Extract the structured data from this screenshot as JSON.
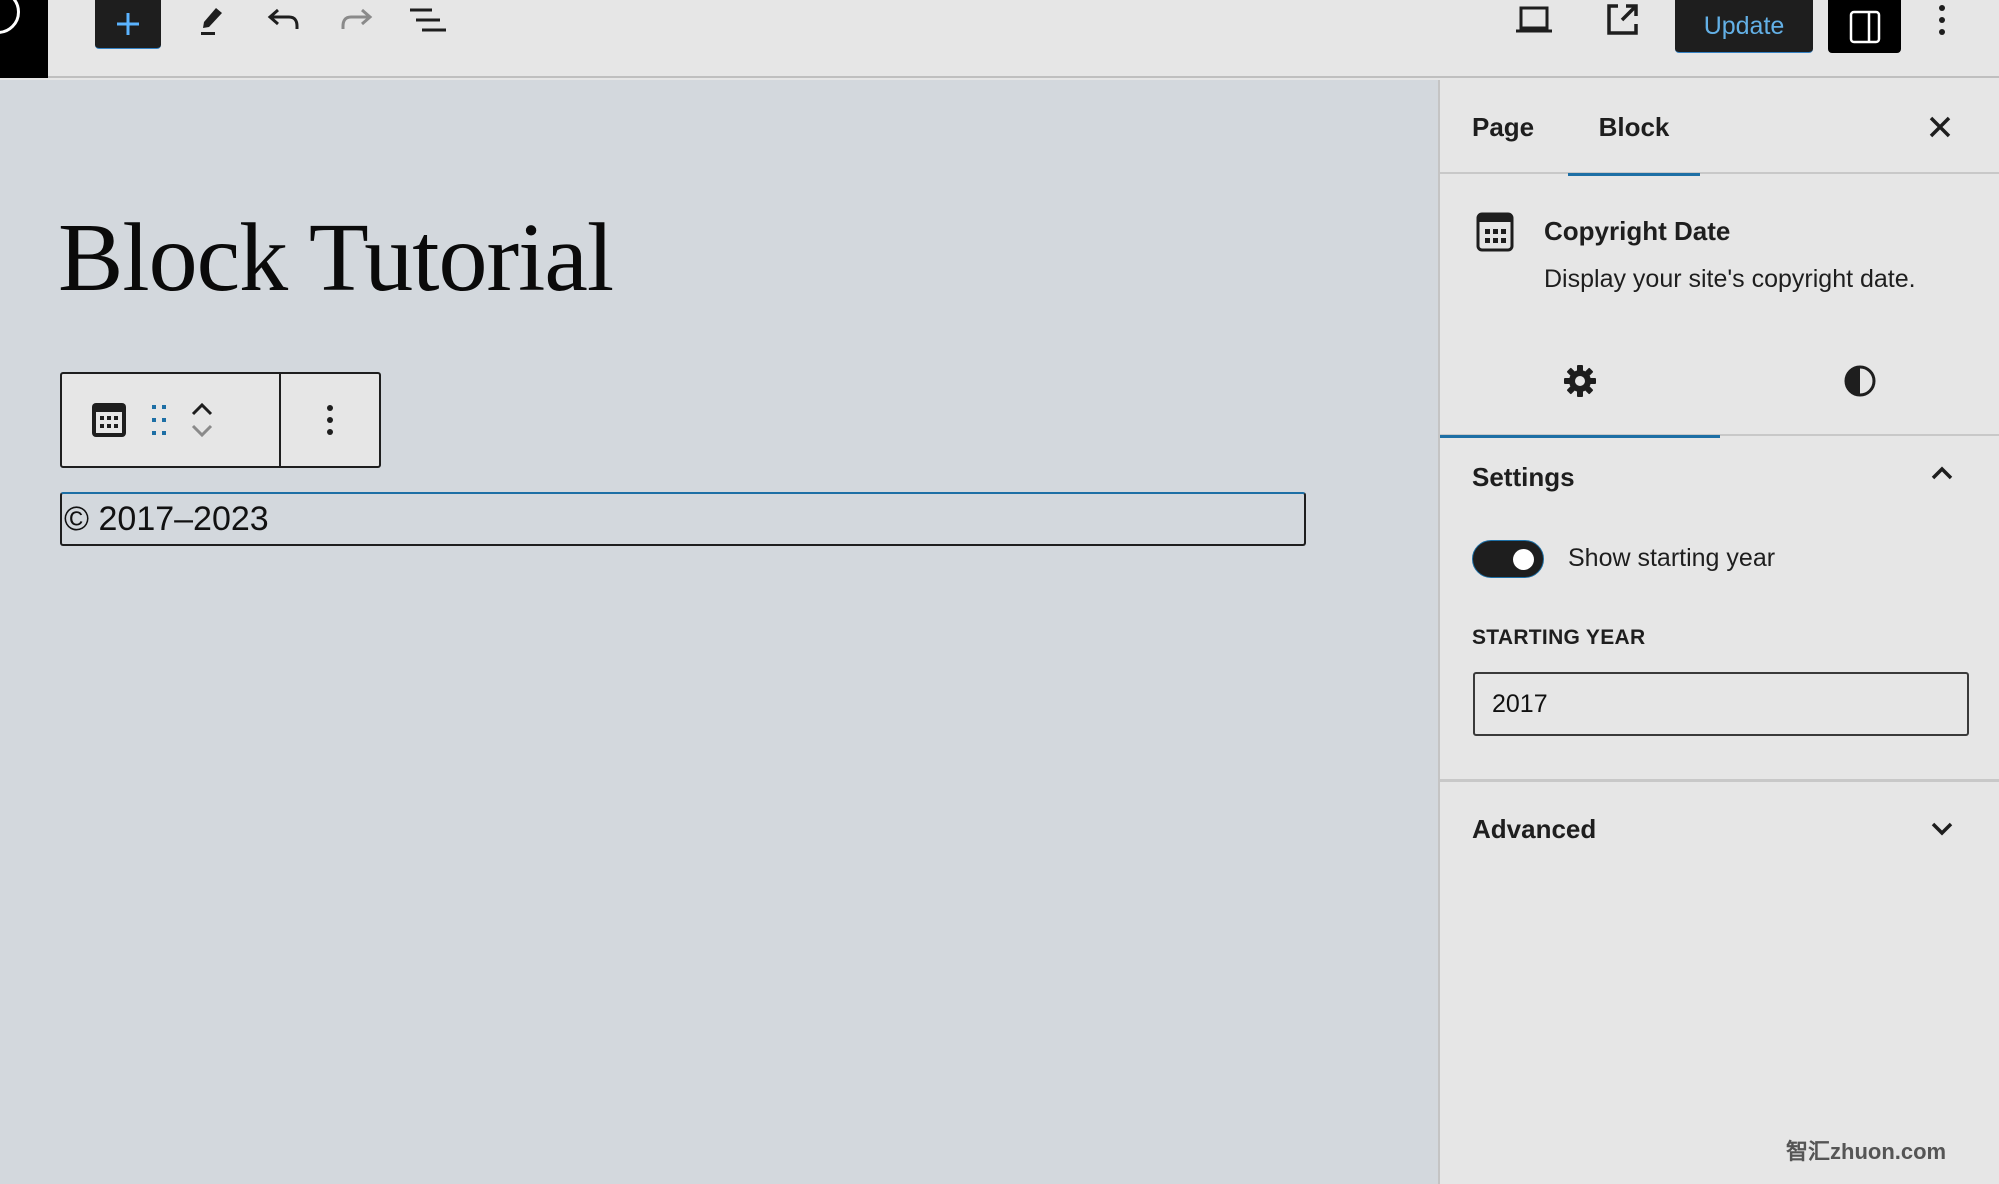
{
  "topbar": {
    "logo_icon": "wordpress-logo-icon",
    "inserter_icon": "plus-icon",
    "tools_icon": "pencil-icon",
    "undo_icon": "undo-icon",
    "redo_icon": "redo-icon",
    "list_view_icon": "list-view-icon",
    "preview_icon": "laptop-icon",
    "view_post_icon": "external-link-icon",
    "update_label": "Update",
    "settings_icon": "sidebar-toggle-icon",
    "options_icon": "more-vertical-icon"
  },
  "editor": {
    "post_title": "Block Tutorial",
    "block_toolbar": {
      "block_icon": "calendar-icon",
      "drag_icon": "drag-handle-icon",
      "move_up_icon": "chevron-up-icon",
      "move_down_icon": "chevron-down-icon",
      "options_icon": "more-vertical-icon"
    },
    "paragraph_text": "© 2017–2023"
  },
  "sidebar": {
    "tabs": [
      {
        "label": "Page",
        "active": false
      },
      {
        "label": "Block",
        "active": true
      }
    ],
    "close_icon": "close-icon",
    "block_card": {
      "icon": "calendar-icon",
      "title": "Copyright Date",
      "description": "Display your site's copyright date."
    },
    "style_tabs": [
      {
        "icon": "gear-icon",
        "active": true
      },
      {
        "icon": "contrast-icon",
        "active": false
      }
    ],
    "settings_panel": {
      "title": "Settings",
      "expanded": true,
      "toggle_label": "Show starting year",
      "toggle_on": true,
      "field_label": "STARTING YEAR",
      "field_value": "2017"
    },
    "advanced_panel": {
      "title": "Advanced",
      "expanded": false
    }
  },
  "accent_color": "#1d6fa5",
  "watermark": "智汇zhuon.com"
}
